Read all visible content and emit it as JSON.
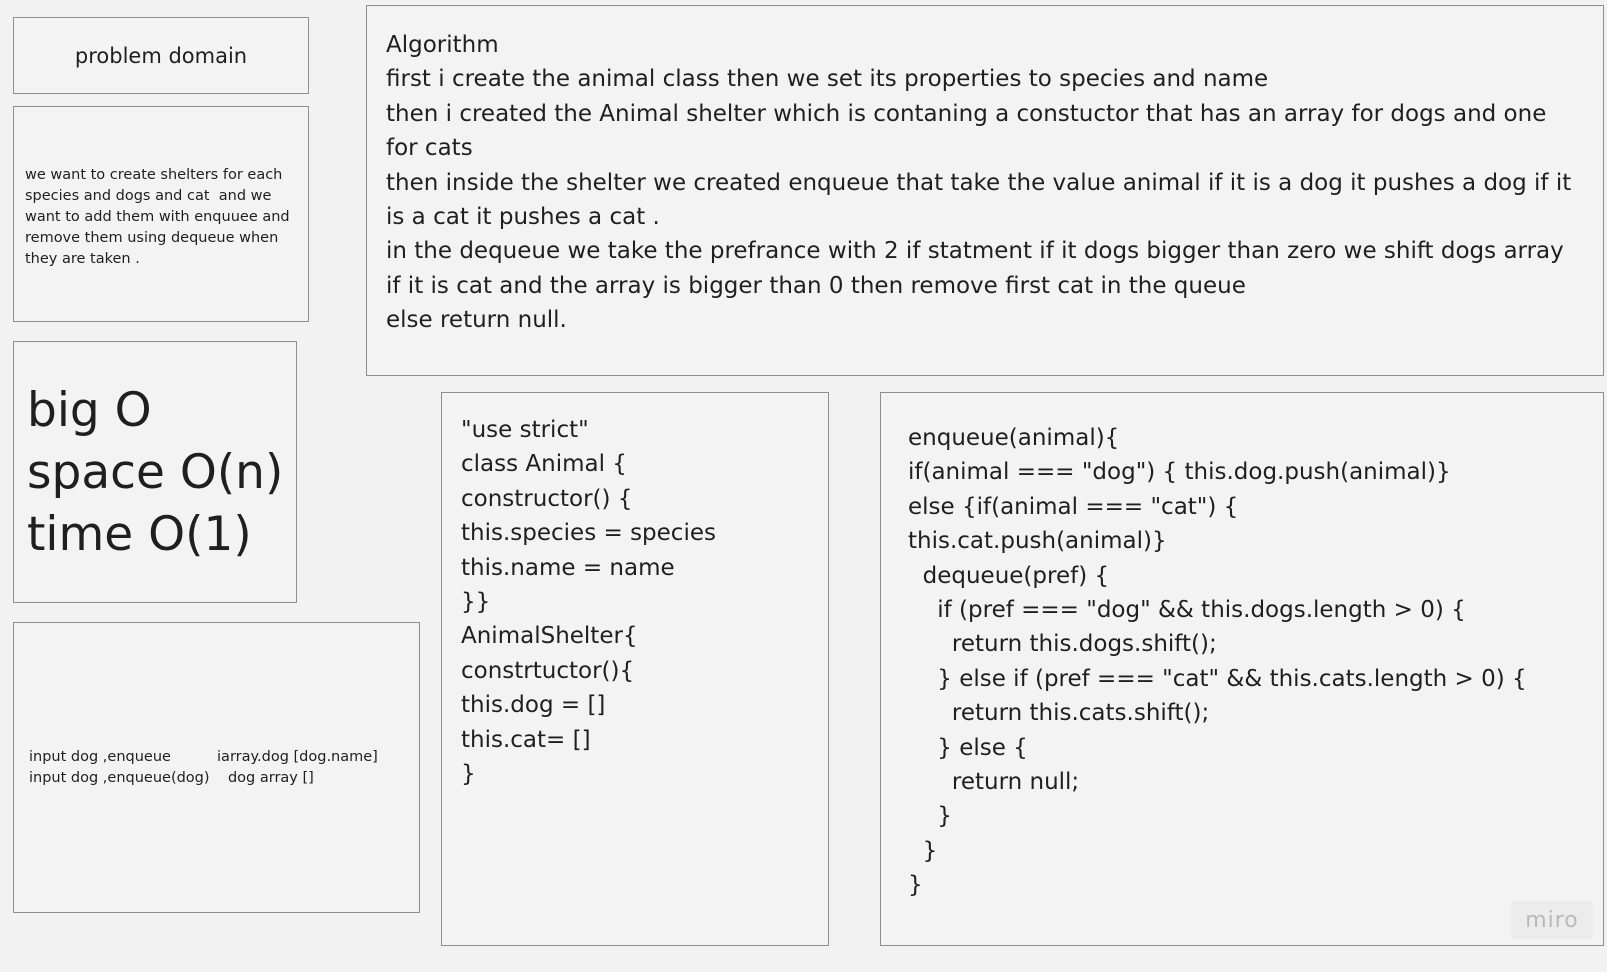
{
  "title_box": {
    "text": "problem domain"
  },
  "description_box": {
    "lines": [
      "we want to create shelters for each",
      "species and dogs and cat  and we",
      "want to add them with enquuee and",
      "remove them using dequeue when",
      "they are taken ."
    ]
  },
  "big_o_box": {
    "lines": [
      "big O",
      "space O(n)",
      "time O(1)"
    ]
  },
  "io_box": {
    "lines": [
      "input dog ,enqueue          iarray.dog [dog.name]",
      "input dog ,enqueue(dog)    dog array []"
    ]
  },
  "algorithm_box": {
    "lines": [
      "Algorithm",
      "first i create the animal class then we set its properties to species and name",
      "then i created the Animal shelter which is contaning a constuctor that has an array for dogs and one",
      "for cats",
      "then inside the shelter we created enqueue that take the value animal if it is a dog it pushes a dog if it",
      "is a cat it pushes a cat .",
      "in the dequeue we take the prefrance with 2 if statment if it dogs bigger than zero we shift dogs array",
      "if it is cat and the array is bigger than 0 then remove first cat in the queue",
      "else return null."
    ]
  },
  "class_code_box": {
    "lines": [
      "\"use strict\"",
      "class Animal {",
      "constructor() {",
      "this.species = species",
      "this.name = name",
      "}}",
      "AnimalShelter{",
      "constrtuctor(){",
      "this.dog = []",
      "this.cat= []",
      "}"
    ]
  },
  "queue_code_box": {
    "lines": [
      "enqueue(animal){",
      "if(animal === \"dog\") { this.dog.push(animal)}",
      "else {if(animal === \"cat\") {",
      "this.cat.push(animal)}",
      "  dequeue(pref) {",
      "    if (pref === \"dog\" && this.dogs.length > 0) {",
      "      return this.dogs.shift();",
      "    } else if (pref === \"cat\" && this.cats.length > 0) {",
      "      return this.cats.shift();",
      "    } else {",
      "      return null;",
      "    }",
      "  }",
      "}"
    ]
  },
  "watermark": {
    "text": "miro"
  }
}
